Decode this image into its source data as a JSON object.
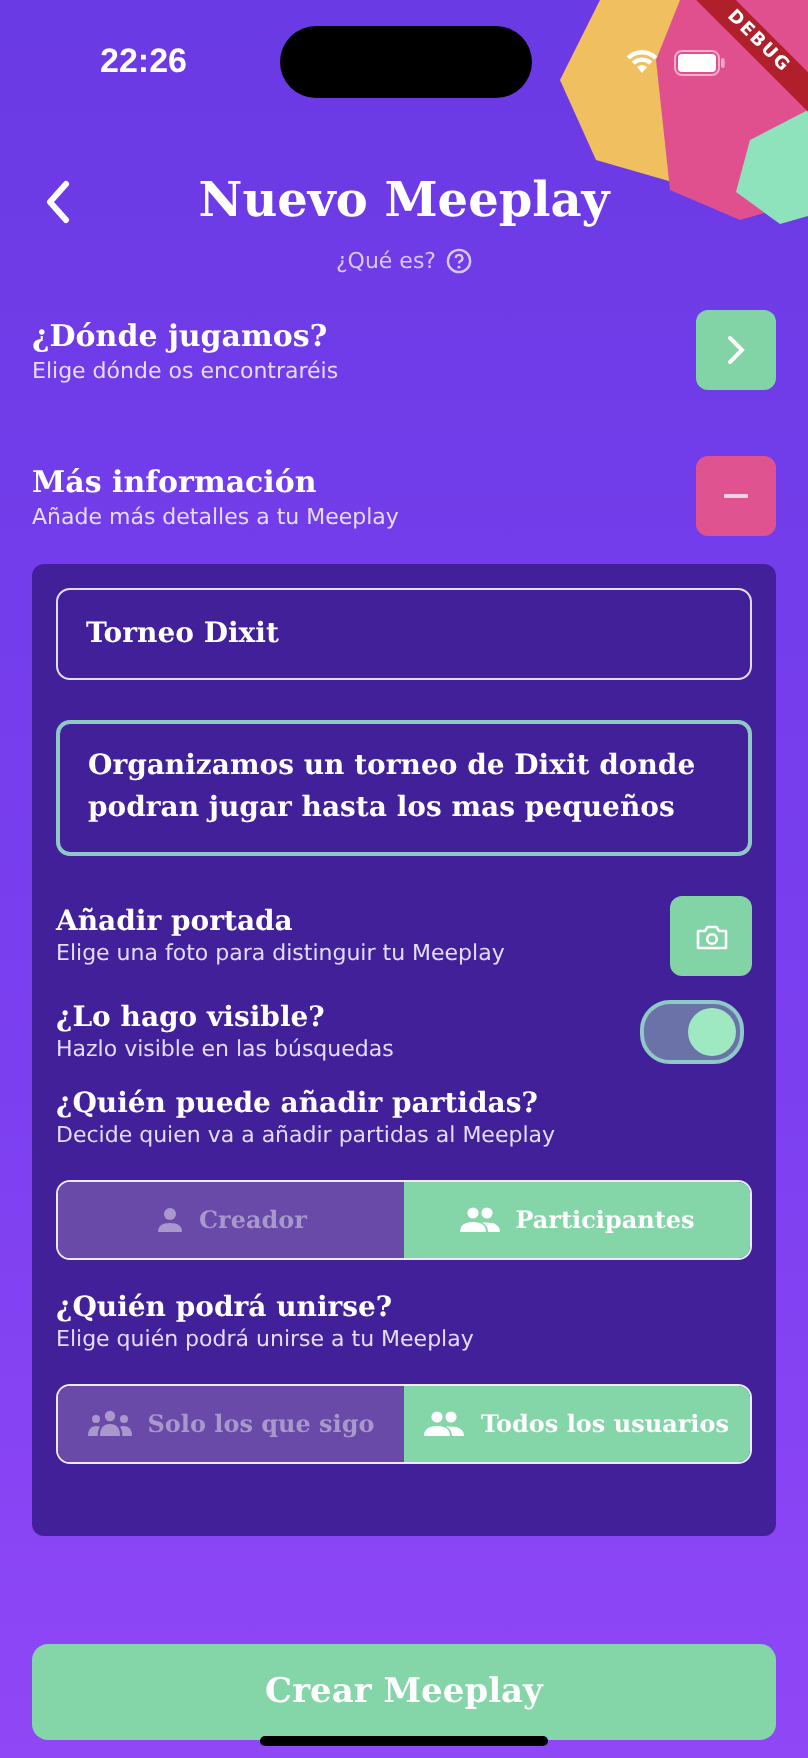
{
  "status_bar": {
    "time": "22:26"
  },
  "debug_banner": "DEBUG",
  "header": {
    "title": "Nuevo Meeplay",
    "help_link": "¿Qué es?"
  },
  "sections": [
    {
      "title": "¿Dónde jugamos?",
      "subtitle": "Elige dónde os encontraréis",
      "kind": "navigate"
    },
    {
      "title": "Más información",
      "subtitle": "Añade más detalles a tu Meeplay",
      "kind": "collapse"
    }
  ],
  "details": {
    "name_field": {
      "value": "Torneo Dixit",
      "focused": false
    },
    "description_field": {
      "value": "Organizamos un torneo de Dixit donde podran jugar hasta los mas pequeños",
      "focused": true
    },
    "options": [
      {
        "kind": "photo",
        "title": "Añadir portada",
        "subtitle": "Elige una foto para distinguir tu Meeplay"
      },
      {
        "kind": "toggle",
        "title": "¿Lo hago visible?",
        "subtitle": "Hazlo visible en las búsquedas",
        "on": true
      },
      {
        "kind": "segmented",
        "title": "¿Quién puede añadir partidas?",
        "subtitle": "Decide quien va a añadir partidas al Meeplay",
        "segments": [
          {
            "label": "Creador",
            "kind": "person",
            "selected": false
          },
          {
            "label": "Participantes",
            "kind": "people",
            "selected": true
          }
        ]
      },
      {
        "kind": "segmented",
        "title": "¿Quién podrá unirse?",
        "subtitle": "Elige quién podrá unirse a tu Meeplay",
        "segments": [
          {
            "label": "Solo los que sigo",
            "kind": "crowd",
            "selected": false
          },
          {
            "label": "Todos los usuarios",
            "kind": "people",
            "selected": true
          }
        ]
      }
    ]
  },
  "submit_button": "Crear Meeplay"
}
